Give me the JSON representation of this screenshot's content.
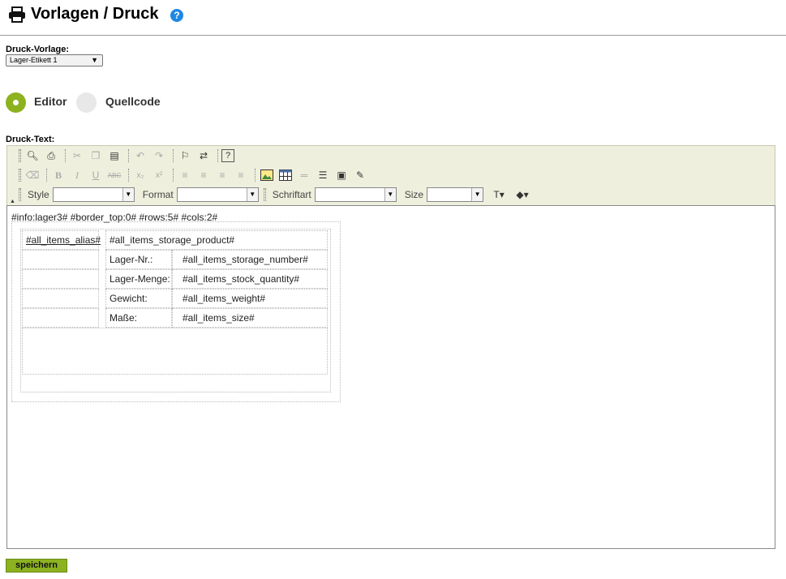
{
  "header": {
    "title": "Vorlagen / Druck",
    "help_label": "?"
  },
  "template_select": {
    "label": "Druck-Vorlage:",
    "value": "Lager-Etikett 1"
  },
  "mode": {
    "editor_label": "Editor",
    "source_label": "Quellcode",
    "selected": "editor"
  },
  "print_text": {
    "label": "Druck-Text:"
  },
  "toolbar": {
    "style_label": "Style",
    "format_label": "Format",
    "font_label": "Schriftart",
    "size_label": "Size"
  },
  "editor": {
    "info_line": "#info:lager3# #border_top:0# #rows:5# #cols:2#",
    "alias": "#all_items_alias#",
    "product": "#all_items_storage_product#",
    "rows": [
      {
        "label": "Lager-Nr.:",
        "value": "#all_items_storage_number#"
      },
      {
        "label": "Lager-Menge:",
        "value": "#all_items_stock_quantity#"
      },
      {
        "label": "Gewicht:",
        "value": "#all_items_weight#"
      },
      {
        "label": "Maße:",
        "value": "#all_items_size#"
      }
    ]
  },
  "actions": {
    "save_label": "speichern"
  },
  "colors": {
    "accent": "#8cb21f",
    "help": "#1e88e5",
    "toolbar_bg": "#efefde"
  }
}
